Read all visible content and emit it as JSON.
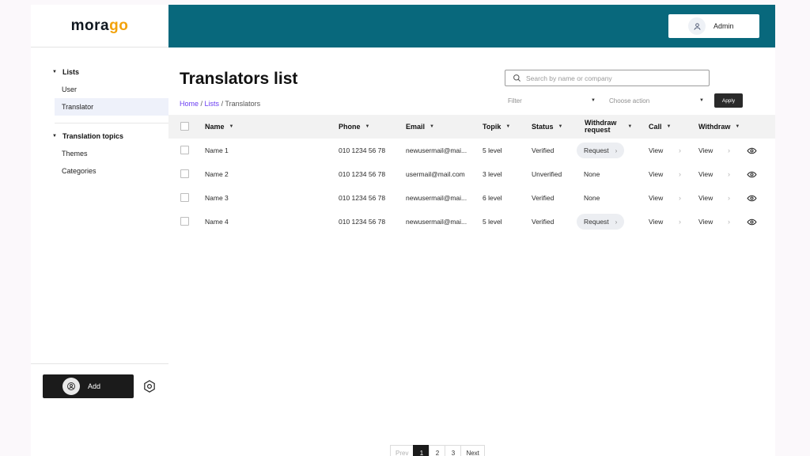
{
  "brand": {
    "logo_left": "mora",
    "logo_right": "go",
    "accent_color": "#f2a20c",
    "header_color": "#08687c"
  },
  "header": {
    "user_label": "Admin"
  },
  "sidebar": {
    "group1": {
      "label": "Lists",
      "items": [
        "User",
        "Translator"
      ],
      "active": "Translator"
    },
    "group2": {
      "label": "Translation topics",
      "items": [
        "Themes",
        "Categories"
      ]
    },
    "add_label": "Add"
  },
  "main": {
    "title": "Translators list",
    "breadcrumb": {
      "home": "Home",
      "lists": "Lists",
      "current": "Translators"
    },
    "search_placeholder": "Search by name or company",
    "filter_label": "Filter",
    "action_label": "Choose action",
    "apply_label": "Apply"
  },
  "table": {
    "headers": {
      "name": "Name",
      "phone": "Phone",
      "email": "Email",
      "topik": "Topik",
      "status": "Status",
      "withdraw_request_1": "Withdraw",
      "withdraw_request_2": "request",
      "call": "Call",
      "withdraw": "Withdraw"
    },
    "rows": [
      {
        "name": "Name 1",
        "phone": "010 1234 56 78",
        "email": "newusermail@mai...",
        "topik": "5 level",
        "status": "Verified",
        "withdraw_request": "Request",
        "call": "View",
        "withdraw": "View"
      },
      {
        "name": "Name 2",
        "phone": "010 1234 56 78",
        "email": "usermail@mail.com",
        "topik": "3 level",
        "status": "Unverified",
        "withdraw_request": "None",
        "call": "View",
        "withdraw": "View"
      },
      {
        "name": "Name 3",
        "phone": "010 1234 56 78",
        "email": "newusermail@mai...",
        "topik": "6 level",
        "status": "Verified",
        "withdraw_request": "None",
        "call": "View",
        "withdraw": "View"
      },
      {
        "name": "Name 4",
        "phone": "010 1234 56 78",
        "email": "newusermail@mai...",
        "topik": "5 level",
        "status": "Verified",
        "withdraw_request": "Request",
        "call": "View",
        "withdraw": "View"
      }
    ]
  },
  "pagination": {
    "prev": "Prev",
    "pages": [
      "1",
      "2",
      "3"
    ],
    "current": "1",
    "next": "Next"
  }
}
